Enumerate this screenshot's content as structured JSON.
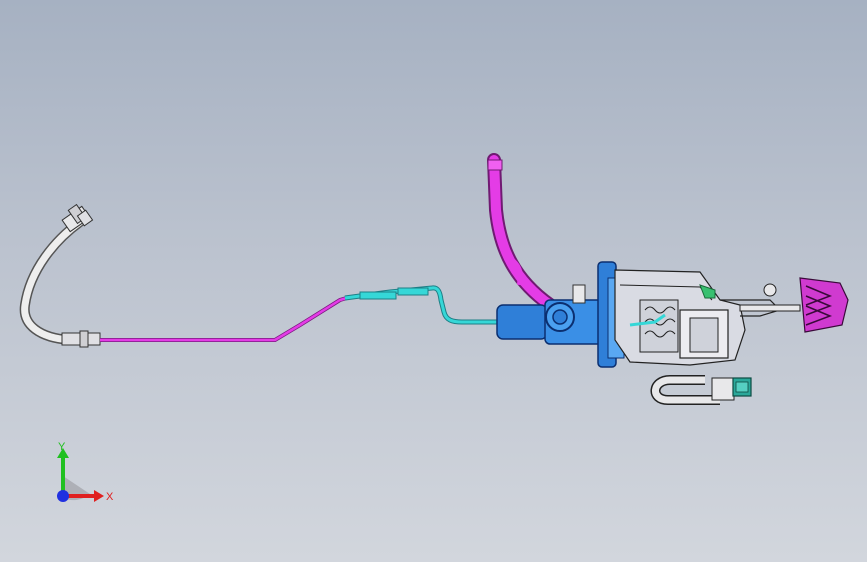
{
  "viewport": {
    "background_top": "#a6b1c2",
    "background_bottom": "#d2d6dd"
  },
  "model": {
    "parts": [
      {
        "name": "braided-hose",
        "color": "#e8e8ea"
      },
      {
        "name": "brake-line-magenta",
        "color": "#e43ce6"
      },
      {
        "name": "brake-line-cyan",
        "color": "#35d7d7"
      },
      {
        "name": "reservoir-pipe",
        "color": "#e43ce6"
      },
      {
        "name": "master-cylinder",
        "color": "#2f7fd8"
      },
      {
        "name": "pedal-bracket",
        "color": "#d9dbe3"
      },
      {
        "name": "brake-pedal-pad",
        "color": "#d03ad0"
      },
      {
        "name": "sensor-connector",
        "color": "#2aa89a"
      }
    ]
  },
  "triad": {
    "x_label": "X",
    "y_label": "Y",
    "x_color": "#e02020",
    "y_color": "#20c020",
    "z_color": "#2030e0"
  }
}
